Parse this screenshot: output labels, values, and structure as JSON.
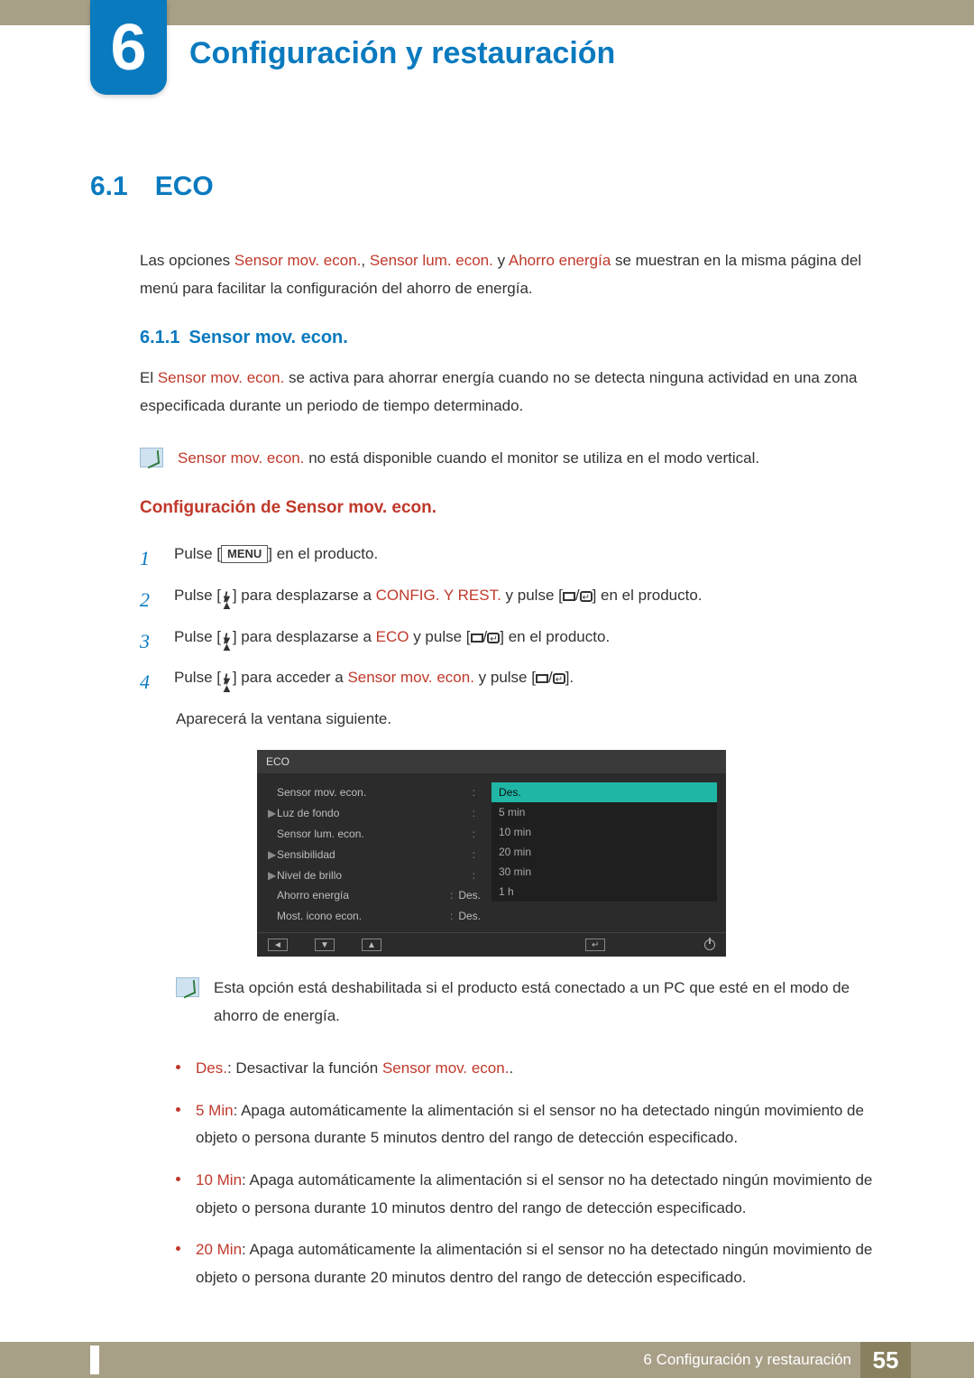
{
  "chapter": {
    "number": "6",
    "title": "Configuración y restauración"
  },
  "section": {
    "number": "6.1",
    "title": "ECO",
    "intro_pre": "Las opciones ",
    "intro_terms": [
      "Sensor mov. econ.",
      "Sensor lum. econ.",
      "Ahorro energía"
    ],
    "intro_join1": ", ",
    "intro_join2": " y ",
    "intro_post": " se muestran en la misma página del menú para facilitar la configuración del ahorro de energía."
  },
  "subsection": {
    "number": "6.1.1",
    "title": "Sensor mov. econ.",
    "desc_pre": "El ",
    "desc_term": "Sensor mov. econ.",
    "desc_post": " se activa para ahorrar energía cuando no se detecta ninguna actividad en una zona especificada durante un periodo de tiempo determinado."
  },
  "note1_term": "Sensor mov. econ.",
  "note1_text": " no está disponible cuando el monitor se utiliza en el modo vertical.",
  "config_heading": "Configuración de Sensor mov. econ.",
  "steps": {
    "s1_a": "Pulse [",
    "s1_key": "MENU",
    "s1_b": "] en el producto.",
    "s2_a": "Pulse [",
    "s2_b": "] para desplazarse a ",
    "s2_term": "CONFIG. Y REST.",
    "s2_c": " y pulse [",
    "s2_d": "] en el producto.",
    "s3_a": "Pulse [",
    "s3_b": "] para desplazarse a ",
    "s3_term": "ECO",
    "s3_c": " y pulse [",
    "s3_d": "] en el producto.",
    "s4_a": "Pulse [",
    "s4_b": "] para acceder a ",
    "s4_term": "Sensor mov. econ.",
    "s4_c": " y pulse [",
    "s4_d": "].",
    "s4_tail": "Aparecerá la ventana siguiente."
  },
  "osd": {
    "title": "ECO",
    "rows": [
      {
        "caret": "",
        "label": "Sensor mov. econ.",
        "val": ""
      },
      {
        "caret": "▶",
        "label": "Luz de fondo",
        "val": ""
      },
      {
        "caret": "",
        "label": "Sensor lum. econ.",
        "val": ""
      },
      {
        "caret": "▶",
        "label": "Sensibilidad",
        "val": ""
      },
      {
        "caret": "▶",
        "label": "Nivel de brillo",
        "val": ""
      },
      {
        "caret": "",
        "label": "Ahorro energía",
        "val": "Des."
      },
      {
        "caret": "",
        "label": "Most. icono econ.",
        "val": "Des."
      }
    ],
    "options": [
      "Des.",
      "5 min",
      "10 min",
      "20 min",
      "30 min",
      "1 h"
    ],
    "selected_index": 0
  },
  "note2": "Esta opción está deshabilitada si el producto está conectado a un PC que esté en el modo de ahorro de energía.",
  "bullets": [
    {
      "term": "Des.",
      "colon": ": ",
      "mid": "Desactivar la función ",
      "term2": "Sensor mov. econ.",
      "post": "."
    },
    {
      "term": "5 Min",
      "colon": ": ",
      "post": "Apaga automáticamente la alimentación si el sensor no ha detectado ningún movimiento de objeto o persona durante 5 minutos dentro del rango de detección especificado."
    },
    {
      "term": "10 Min",
      "colon": ": ",
      "post": "Apaga automáticamente la alimentación si el sensor no ha detectado ningún movimiento de objeto o persona durante 10 minutos dentro del rango de detección especificado."
    },
    {
      "term": "20 Min",
      "colon": ": ",
      "post": "Apaga automáticamente la alimentación si el sensor no ha detectado ningún movimiento de objeto o persona durante 20 minutos dentro del rango de detección especificado."
    }
  ],
  "footer": {
    "label": "6 Configuración y restauración",
    "page": "55"
  }
}
